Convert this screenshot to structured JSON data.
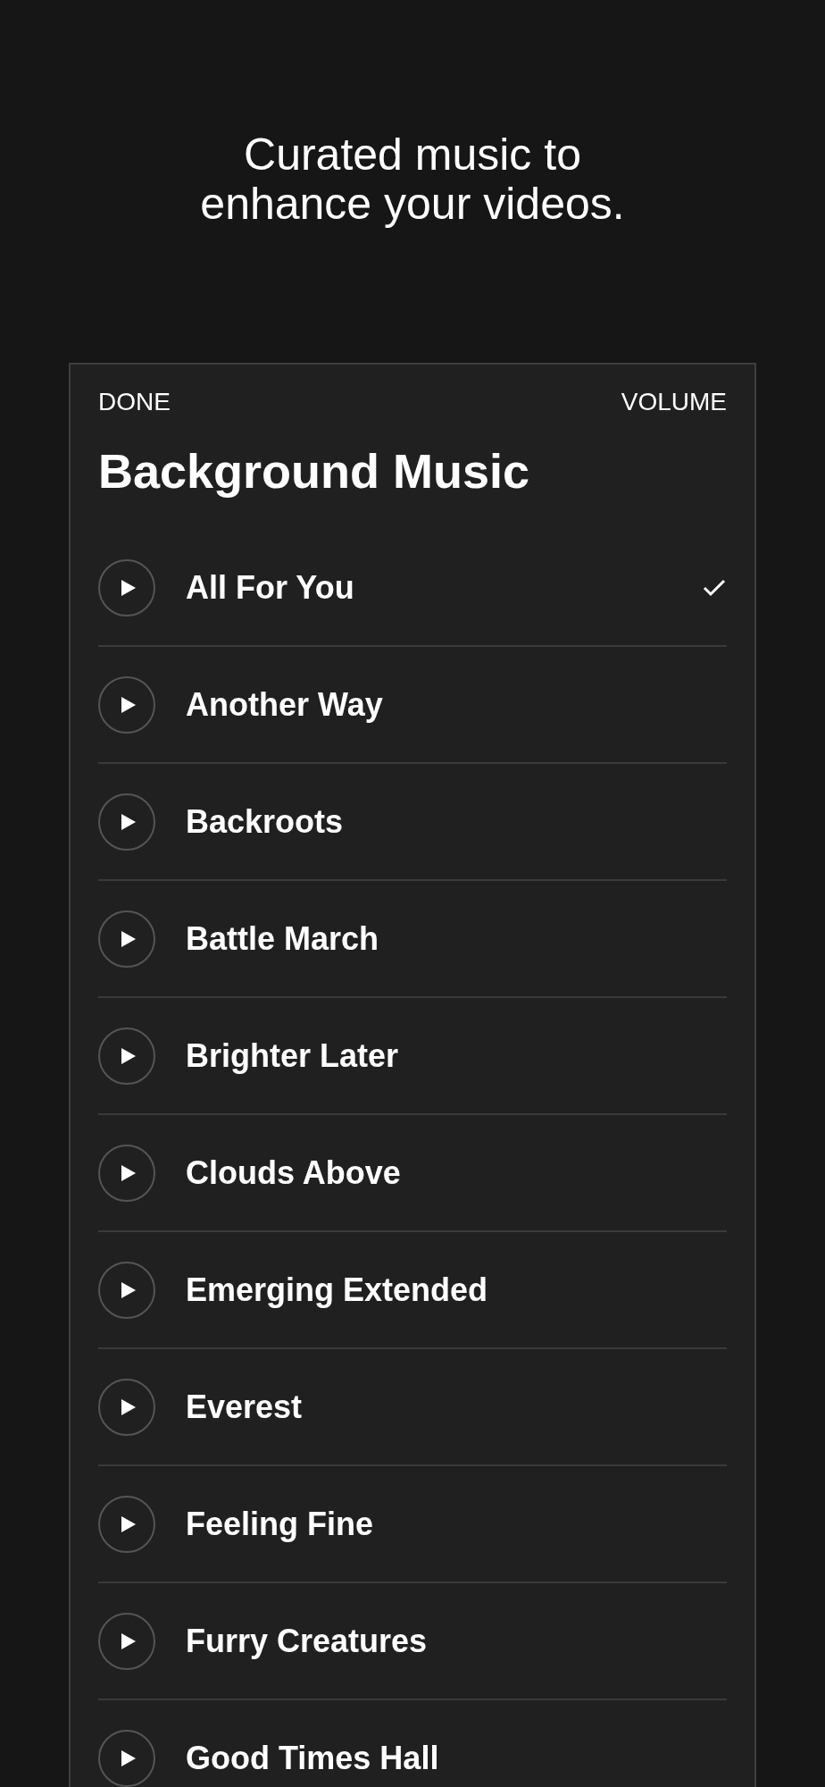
{
  "headline": "Curated music to enhance your videos.",
  "panel": {
    "left_button": "DONE",
    "right_button": "VOLUME",
    "title": "Background Music"
  },
  "tracks": [
    {
      "title": "All For You",
      "selected": true
    },
    {
      "title": "Another Way",
      "selected": false
    },
    {
      "title": "Backroots",
      "selected": false
    },
    {
      "title": "Battle March",
      "selected": false
    },
    {
      "title": "Brighter Later",
      "selected": false
    },
    {
      "title": "Clouds Above",
      "selected": false
    },
    {
      "title": "Emerging Extended",
      "selected": false
    },
    {
      "title": "Everest",
      "selected": false
    },
    {
      "title": "Feeling Fine",
      "selected": false
    },
    {
      "title": "Furry Creatures",
      "selected": false
    },
    {
      "title": "Good Times Hall",
      "selected": false
    }
  ]
}
